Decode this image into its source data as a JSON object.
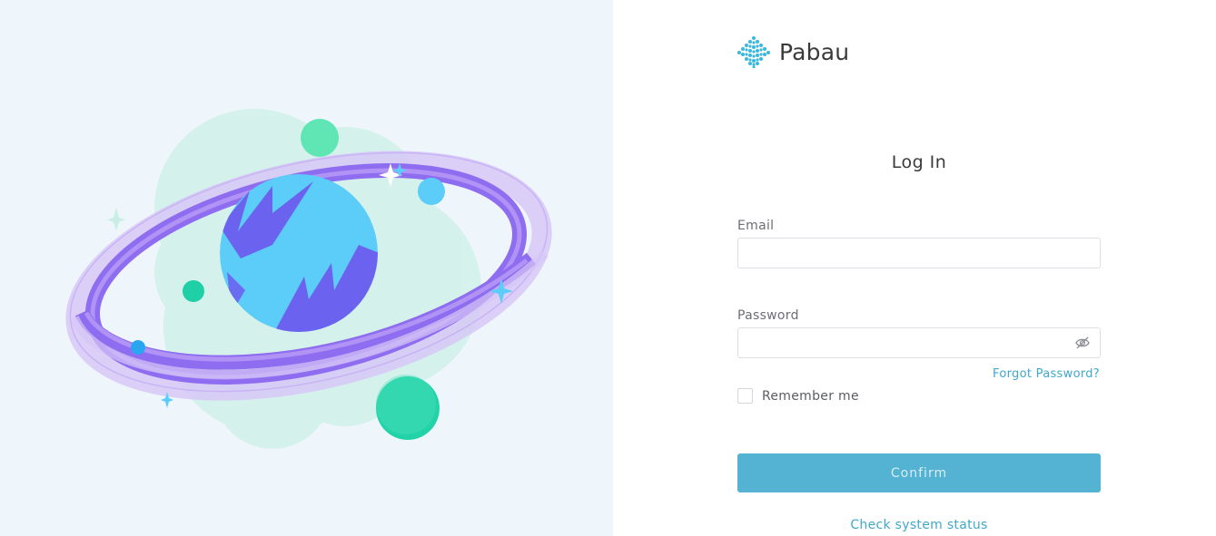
{
  "brand": {
    "name": "Pabau",
    "logo_icon": "pabau-diamond-dots-icon"
  },
  "login": {
    "title": "Log In",
    "email_label": "Email",
    "email_value": "",
    "email_placeholder": "",
    "password_label": "Password",
    "password_value": "",
    "password_placeholder": "",
    "password_toggle_icon": "eye-off-icon",
    "forgot_password": "Forgot Password?",
    "remember_me": "Remember me",
    "remember_checked": false,
    "confirm_label": "Confirm",
    "system_status_link": "Check system status"
  },
  "illustration": {
    "subject": "planet-with-ring-illustration"
  },
  "colors": {
    "accent": "#40a9c9",
    "button": "#54b2d3",
    "left_panel_bg": "#eef6fc",
    "planet_blue": "#5bcdf8",
    "planet_purple": "#6b63f0",
    "ring_purple": "#9b7af2",
    "moon_green": "#22d3a8"
  }
}
